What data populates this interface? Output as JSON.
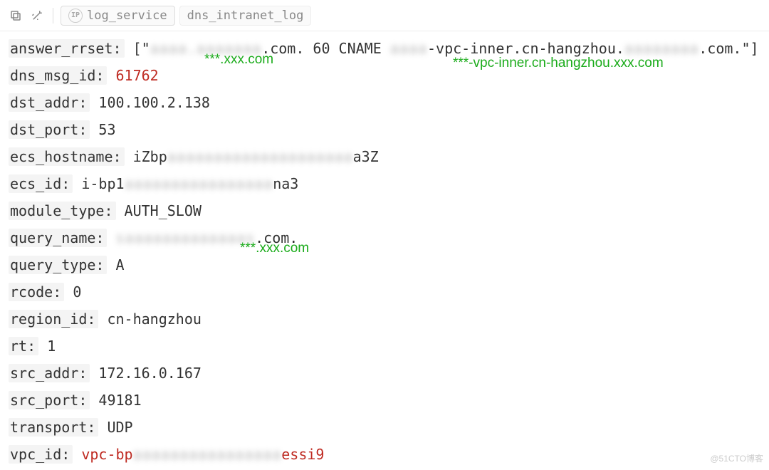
{
  "toolbar": {
    "breadcrumb1": "log_service",
    "breadcrumb2": "dns_intranet_log"
  },
  "fields": {
    "answer_rrset": {
      "key": "answer_rrset",
      "prefix": "[\"",
      "redact1": "aaaa.aaaaaaa",
      "mid1": ".com. 60 CNAME ",
      "redact2": "aaaa",
      "mid2": "-vpc-inner.cn-hangzhou.",
      "redact3": "aaaaaaaa",
      "suffix": ".com.\"]"
    },
    "dns_msg_id": {
      "key": "dns_msg_id",
      "value": "61762"
    },
    "dst_addr": {
      "key": "dst_addr",
      "value": "100.100.2.138"
    },
    "dst_port": {
      "key": "dst_port",
      "value": "53"
    },
    "ecs_hostname": {
      "key": "ecs_hostname",
      "prefix": "iZbp",
      "redact": "aaaaaaaaaaaaaaaaaaaa",
      "suffix": "a3Z"
    },
    "ecs_id": {
      "key": "ecs_id",
      "prefix": "i-bp1",
      "redact": "aaaaaaaaaaaaaaaa",
      "suffix": "na3"
    },
    "module_type": {
      "key": "module_type",
      "value": "AUTH_SLOW"
    },
    "query_name": {
      "key": "query_name",
      "redact": "saaaaaaaaaaaaas",
      "suffix": ".com."
    },
    "query_type": {
      "key": "query_type",
      "value": "A"
    },
    "rcode": {
      "key": "rcode",
      "value": "0"
    },
    "region_id": {
      "key": "region_id",
      "value": "cn-hangzhou"
    },
    "rt": {
      "key": "rt",
      "value": "1"
    },
    "src_addr": {
      "key": "src_addr",
      "value": "172.16.0.167"
    },
    "src_port": {
      "key": "src_port",
      "value": "49181"
    },
    "transport": {
      "key": "transport",
      "value": "UDP"
    },
    "vpc_id": {
      "key": "vpc_id",
      "prefix": "vpc-bp",
      "redact": "aaaaaaaaaaaaaaaa",
      "suffix": "essi9"
    }
  },
  "annotations": {
    "a1": "***.xxx.com",
    "a2": "***-vpc-inner.cn-hangzhou.xxx.com",
    "a3": "***.xxx.com"
  },
  "watermark": "@51CTO博客"
}
